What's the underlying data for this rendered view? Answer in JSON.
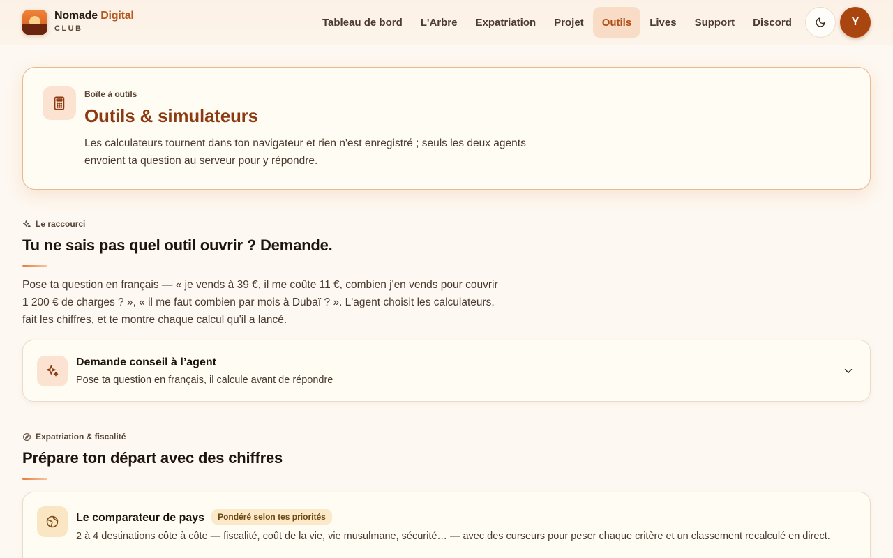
{
  "brand": {
    "name_part1": "Nomade",
    "name_part2": "Digital",
    "sub": "CLUB"
  },
  "nav": {
    "items": [
      {
        "label": "Tableau de bord",
        "active": false
      },
      {
        "label": "L'Arbre",
        "active": false
      },
      {
        "label": "Expatriation",
        "active": false
      },
      {
        "label": "Projet",
        "active": false
      },
      {
        "label": "Outils",
        "active": true
      },
      {
        "label": "Lives",
        "active": false
      },
      {
        "label": "Support",
        "active": false
      },
      {
        "label": "Discord",
        "active": false
      }
    ],
    "theme_icon": "moon-icon",
    "avatar_initial": "Y"
  },
  "hero": {
    "icon": "calculator-icon",
    "eyebrow": "Boîte à outils",
    "title": "Outils & simulateurs",
    "description": "Les calculateurs tournent dans ton navigateur et rien n'est enregistré ; seuls les deux agents envoient ta question au serveur pour y répondre."
  },
  "shortcut": {
    "eyebrow_icon": "sparkles-icon",
    "eyebrow": "Le raccourci",
    "title": "Tu ne sais pas quel outil ouvrir ? Demande.",
    "description": "Pose ta question en français — « je vends à 39 €, il me coûte 11 €, combien j'en vends pour couvrir 1 200 € de charges ? », « il me faut combien par mois à Dubaï ? ». L'agent choisit les calculateurs, fait les chiffres, et te montre chaque calcul qu'il a lancé.",
    "agent_card": {
      "icon": "sparkles-icon",
      "title": "Demande conseil à l’agent",
      "subtitle": "Pose ta question en français, il calcule avant de répondre",
      "expand_icon": "chevron-down-icon"
    }
  },
  "expat": {
    "eyebrow_icon": "compass-icon",
    "eyebrow": "Expatriation & fiscalité",
    "title": "Prépare ton départ avec des chiffres",
    "comparator": {
      "icon": "globe-icon",
      "title": "Le comparateur de pays",
      "badge": "Pondéré selon tes priorités",
      "description": "2 à 4 destinations côte à côte — fiscalité, coût de la vie, vie musulmane, sécurité… — avec des curseurs pour peser chaque critère et un classement recalculé en direct."
    }
  },
  "colors": {
    "accent": "#b04d17",
    "title_brown": "#8b3a12",
    "background": "#fdf8f1"
  }
}
